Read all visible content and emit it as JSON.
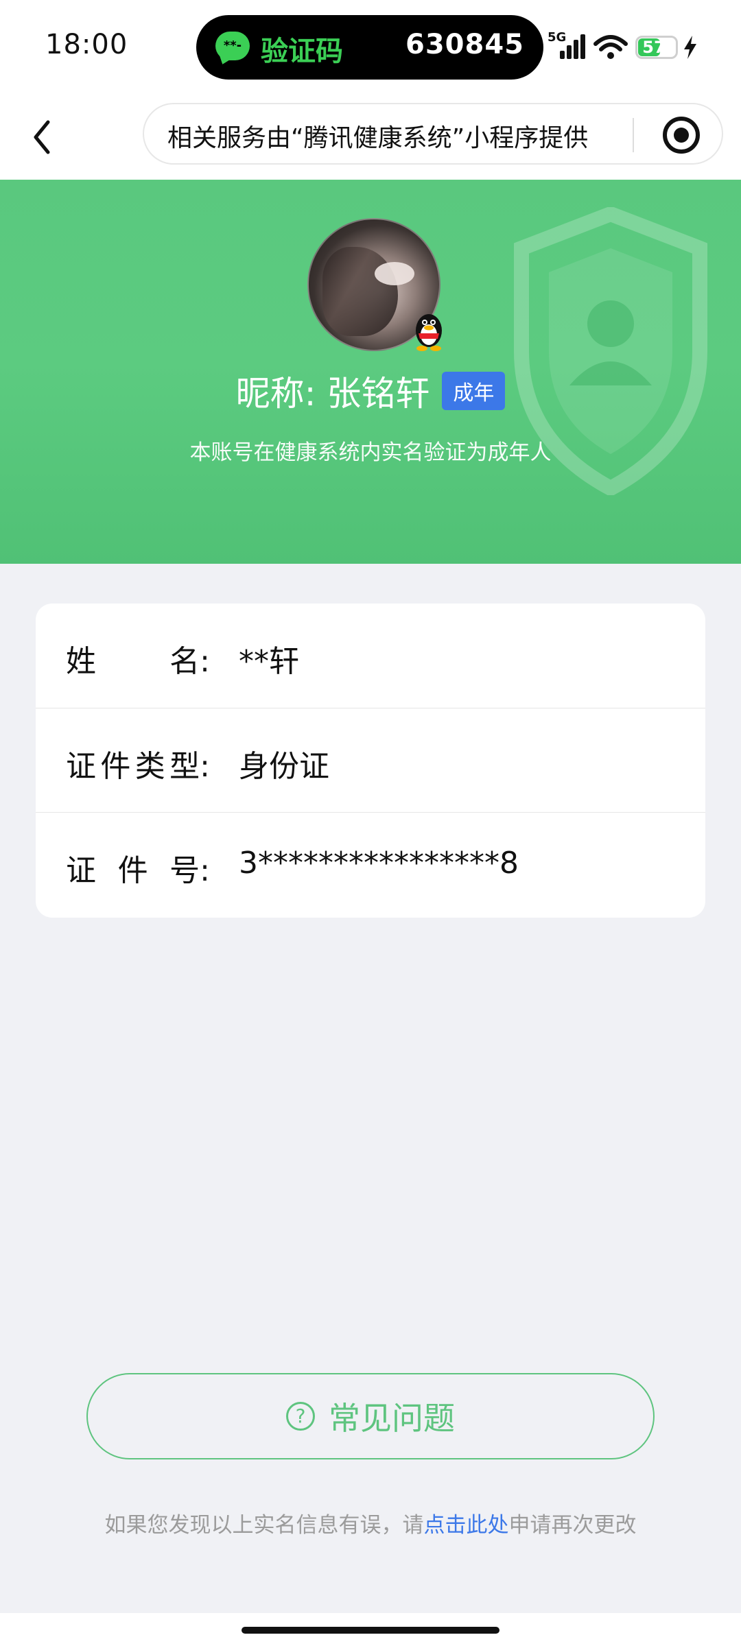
{
  "status_bar": {
    "time": "18:00",
    "sms_label": "验证码",
    "sms_code": "630845",
    "sms_icon_text": "**-",
    "network": "5G",
    "battery_percent": "57",
    "battery_level": 0.57,
    "charging": true,
    "accent_color": "#3bcf55"
  },
  "nav": {
    "back_icon": "chevron-left-icon",
    "capsule_text": "相关服务由“腾讯健康系统”小程序提供",
    "target_icon": "target-icon"
  },
  "profile": {
    "nickname": "昵称: 张铭轩",
    "age_badge": "成年",
    "verify_note": "本账号在健康系统内实名验证为成年人",
    "hero_color": "#5cc880",
    "badge_color": "#3c78e8"
  },
  "info": {
    "rows": [
      {
        "label_chars": [
          "姓",
          "名:"
        ],
        "value": "**轩"
      },
      {
        "label_chars": [
          "证",
          "件",
          "类",
          "型:"
        ],
        "value": "身份证"
      },
      {
        "label_chars": [
          "证",
          "件",
          "号:"
        ],
        "value": "3****************8"
      }
    ]
  },
  "faq": {
    "icon_text": "?",
    "label": "常见问题",
    "color": "#5ec47f"
  },
  "footer": {
    "prefix": "如果您发现以上实名信息有误，请",
    "link": "点击此处",
    "suffix": "申请再次更改",
    "link_color": "#3c78e8"
  }
}
